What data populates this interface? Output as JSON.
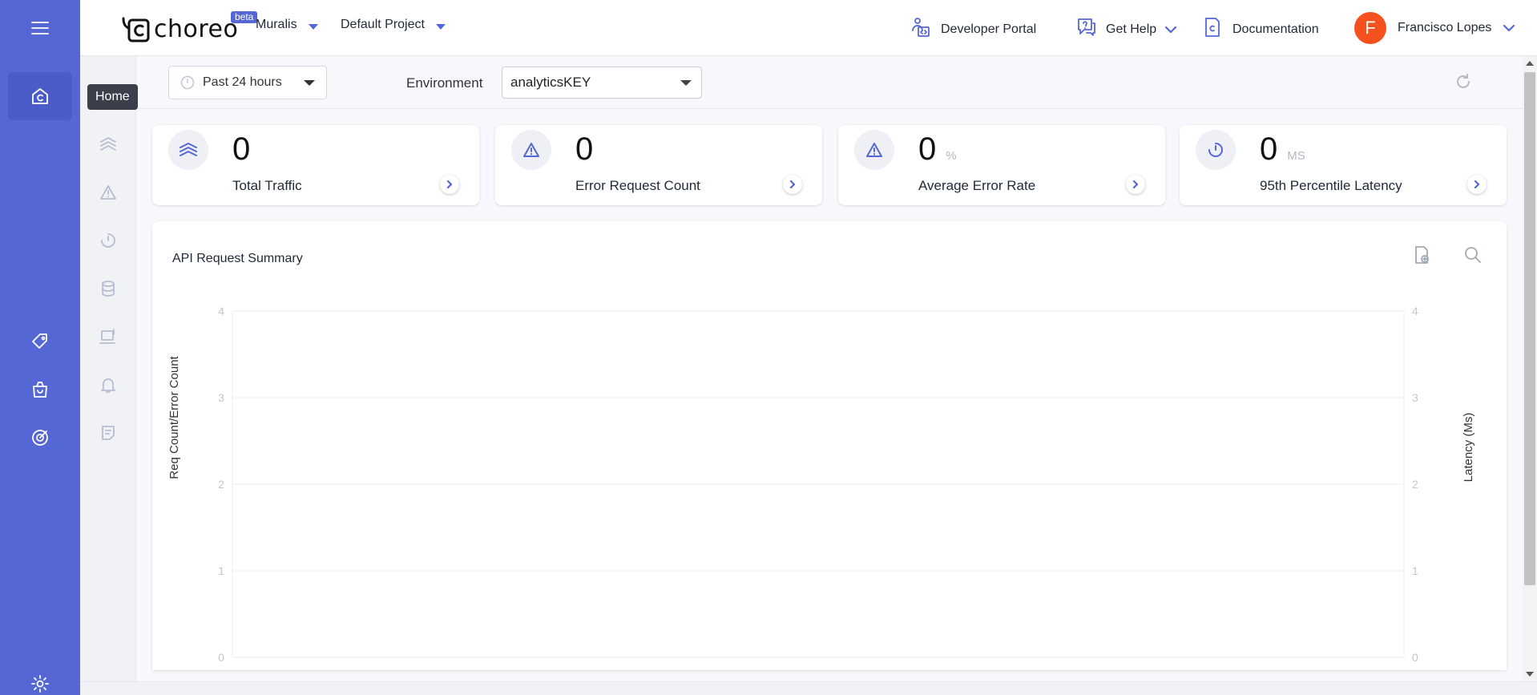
{
  "colors": {
    "primary": "#5567d5",
    "avatar": "#f4511e"
  },
  "rail": {
    "items": [
      {
        "icon": "menu-icon"
      },
      {
        "icon": "home-icon",
        "active": true
      },
      {
        "icon": "tag-icon"
      },
      {
        "icon": "shopping-bag-icon"
      },
      {
        "icon": "target-icon"
      },
      {
        "icon": "settings-icon"
      }
    ]
  },
  "subrail": {
    "items": [
      {
        "icon": "layers-icon"
      },
      {
        "icon": "warning-icon"
      },
      {
        "icon": "gauge-icon"
      },
      {
        "icon": "database-icon"
      },
      {
        "icon": "device-icon"
      },
      {
        "icon": "bell-icon"
      },
      {
        "icon": "report-icon"
      }
    ]
  },
  "tooltip": {
    "text": "Home"
  },
  "header": {
    "brand": "choreo",
    "beta": "beta",
    "org": "Muralis",
    "project": "Default Project",
    "developer_portal": "Developer Portal",
    "get_help": "Get Help",
    "documentation": "Documentation",
    "user_initial": "F",
    "user_name": "Francisco Lopes"
  },
  "filters": {
    "time_range": "Past 24 hours",
    "environment_label": "Environment",
    "environment_value": "analyticsKEY"
  },
  "cards": [
    {
      "value": "0",
      "unit": "",
      "label": "Total Traffic",
      "icon": "layers-icon"
    },
    {
      "value": "0",
      "unit": "",
      "label": "Error Request Count",
      "icon": "warning-icon"
    },
    {
      "value": "0",
      "unit": "%",
      "label": "Average Error Rate",
      "icon": "warning-icon"
    },
    {
      "value": "0",
      "unit": "MS",
      "label": "95th Percentile Latency",
      "icon": "gauge-icon"
    }
  ],
  "panel": {
    "title": "API Request Summary"
  },
  "chart_data": {
    "type": "line",
    "title": "API Request Summary",
    "ylabel": "Req Count/Error Count",
    "y2label": "Latency (Ms)",
    "ylim": [
      0,
      4
    ],
    "y2lim": [
      0,
      4
    ],
    "yticks": [
      "0",
      "1",
      "2",
      "3",
      "4"
    ],
    "y2ticks": [
      "0",
      "1",
      "2",
      "3",
      "4"
    ],
    "grid": true,
    "series": []
  }
}
